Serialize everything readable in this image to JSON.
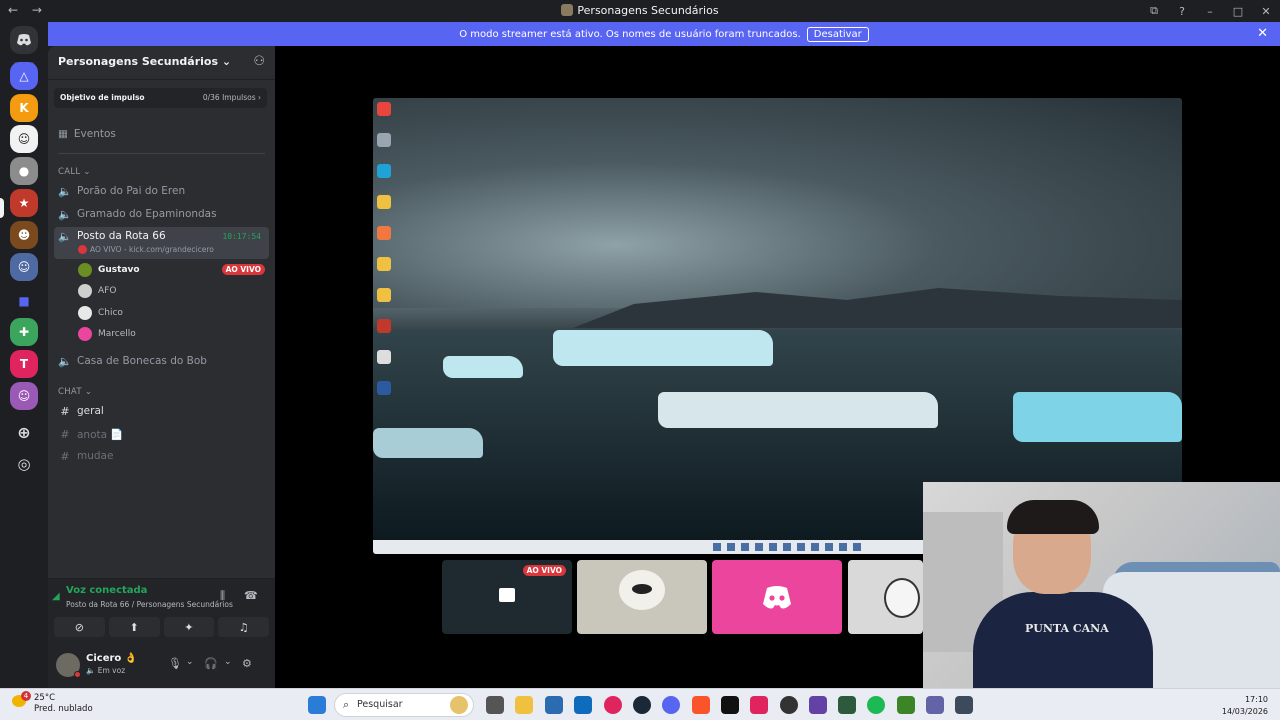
{
  "titlebar": {
    "back": "←",
    "forward": "→",
    "title": "Personagens Secundários",
    "controls": [
      "⧉",
      "?",
      "–",
      "□",
      "✕"
    ]
  },
  "banner": {
    "text": "O modo streamer está ativo. Os nomes de usuário foram truncados.",
    "button": "Desativar",
    "close": "✕"
  },
  "server": {
    "name": "Personagens Secundários",
    "chevron": "⌄",
    "boost": {
      "label": "Objetivo de impulso",
      "value": "0/36 Impulsos ›"
    },
    "events": "Eventos",
    "call_category": "CALL ⌄",
    "chat_category": "CHAT ⌄",
    "voice_channels": [
      {
        "name": "Porão do Pai do Eren"
      },
      {
        "name": "Gramado do Epaminondas"
      },
      {
        "name": "Posto da Rota 66",
        "timer": "10:17:54",
        "sub": "AO VIVO - kick.com/grandecicero"
      },
      {
        "name": "Casa de Bonecas do Bob"
      }
    ],
    "voice_users": [
      {
        "name": "Gustavo",
        "live": "AO VIVO"
      },
      {
        "name": "AFO"
      },
      {
        "name": "Chico"
      },
      {
        "name": "Marcello"
      }
    ],
    "text_channels": [
      {
        "name": "geral"
      },
      {
        "name": "anota 📄"
      },
      {
        "name": "mudae"
      }
    ]
  },
  "voice": {
    "status": "Voz conectada",
    "location": "Posto da Rota 66 / Personagens Secundários",
    "buttons": [
      "⊘",
      "⬆",
      "✦",
      "♫"
    ]
  },
  "user": {
    "name": "Cicero 👌",
    "status": "Em voz"
  },
  "tiles": [
    {
      "live": "AO VIVO"
    }
  ],
  "webcam": {
    "shirt_text": "PUNTA CANA"
  },
  "taskbar": {
    "weather_temp": "25°C",
    "weather_desc": "Pred. nublado",
    "weather_badge": "4",
    "search_placeholder": "Pesquisar",
    "time": "17:10",
    "date": "14/03/2026"
  },
  "colors": {
    "accent": "#5865f2",
    "green": "#23a55a",
    "red": "#da373c",
    "pink": "#eb459e"
  }
}
